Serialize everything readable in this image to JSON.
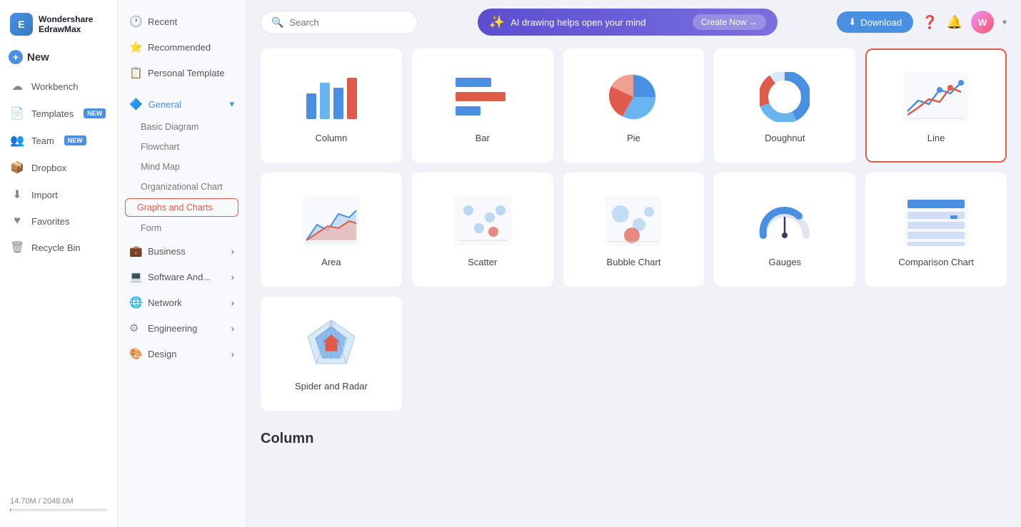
{
  "app": {
    "name": "Wondershare EdrawMax",
    "logo_initials": "E"
  },
  "sidebar": {
    "new_label": "New",
    "items": [
      {
        "id": "workbench",
        "label": "Workbench",
        "icon": "☁"
      },
      {
        "id": "templates",
        "label": "Templates",
        "icon": "📄",
        "badge": "NEW"
      },
      {
        "id": "team",
        "label": "Team",
        "icon": "👥",
        "badge": "NEW"
      },
      {
        "id": "dropbox",
        "label": "Dropbox",
        "icon": "📦"
      },
      {
        "id": "import",
        "label": "Import",
        "icon": "⬇"
      },
      {
        "id": "favorites",
        "label": "Favorites",
        "icon": "♥"
      },
      {
        "id": "recycle",
        "label": "Recycle Bin",
        "icon": "🗑"
      }
    ],
    "storage_label": "14.70M / 2048.0M"
  },
  "nav": {
    "items": [
      {
        "id": "recent",
        "label": "Recent",
        "icon": "🕐"
      },
      {
        "id": "recommended",
        "label": "Recommended",
        "icon": "⭐"
      },
      {
        "id": "personal",
        "label": "Personal Template",
        "icon": "📋"
      }
    ],
    "sections": [
      {
        "id": "general",
        "label": "General",
        "expanded": true,
        "sub_items": [
          {
            "id": "basic",
            "label": "Basic Diagram"
          },
          {
            "id": "flowchart",
            "label": "Flowchart"
          },
          {
            "id": "mindmap",
            "label": "Mind Map"
          },
          {
            "id": "orgchart",
            "label": "Organizational Chart"
          },
          {
            "id": "graphs",
            "label": "Graphs and Charts",
            "active": true
          },
          {
            "id": "form",
            "label": "Form"
          }
        ]
      },
      {
        "id": "business",
        "label": "Business",
        "has_arrow": true
      },
      {
        "id": "software",
        "label": "Software And...",
        "has_arrow": true
      },
      {
        "id": "network",
        "label": "Network",
        "has_arrow": true
      },
      {
        "id": "engineering",
        "label": "Engineering",
        "has_arrow": true
      },
      {
        "id": "design",
        "label": "Design",
        "has_arrow": true
      }
    ]
  },
  "topbar": {
    "search_placeholder": "Search",
    "ai_banner": {
      "icon": "✨",
      "text": "AI drawing helps open your mind",
      "cta": "Create Now →"
    },
    "download_label": "Download"
  },
  "charts": [
    {
      "id": "column",
      "label": "Column",
      "type": "column"
    },
    {
      "id": "bar",
      "label": "Bar",
      "type": "bar"
    },
    {
      "id": "pie",
      "label": "Pie",
      "type": "pie"
    },
    {
      "id": "doughnut",
      "label": "Doughnut",
      "type": "doughnut"
    },
    {
      "id": "line",
      "label": "Line",
      "type": "line",
      "selected": true
    },
    {
      "id": "area",
      "label": "Area",
      "type": "area"
    },
    {
      "id": "scatter",
      "label": "Scatter",
      "type": "scatter"
    },
    {
      "id": "bubble",
      "label": "Bubble Chart",
      "type": "bubble"
    },
    {
      "id": "gauges",
      "label": "Gauges",
      "type": "gauges"
    },
    {
      "id": "comparison",
      "label": "Comparison Chart",
      "type": "comparison"
    },
    {
      "id": "spider",
      "label": "Spider and Radar",
      "type": "spider"
    }
  ],
  "bottom_label": "Column",
  "colors": {
    "primary": "#4a90e2",
    "accent": "#e05a4b",
    "selected_border": "#e05a4b"
  }
}
